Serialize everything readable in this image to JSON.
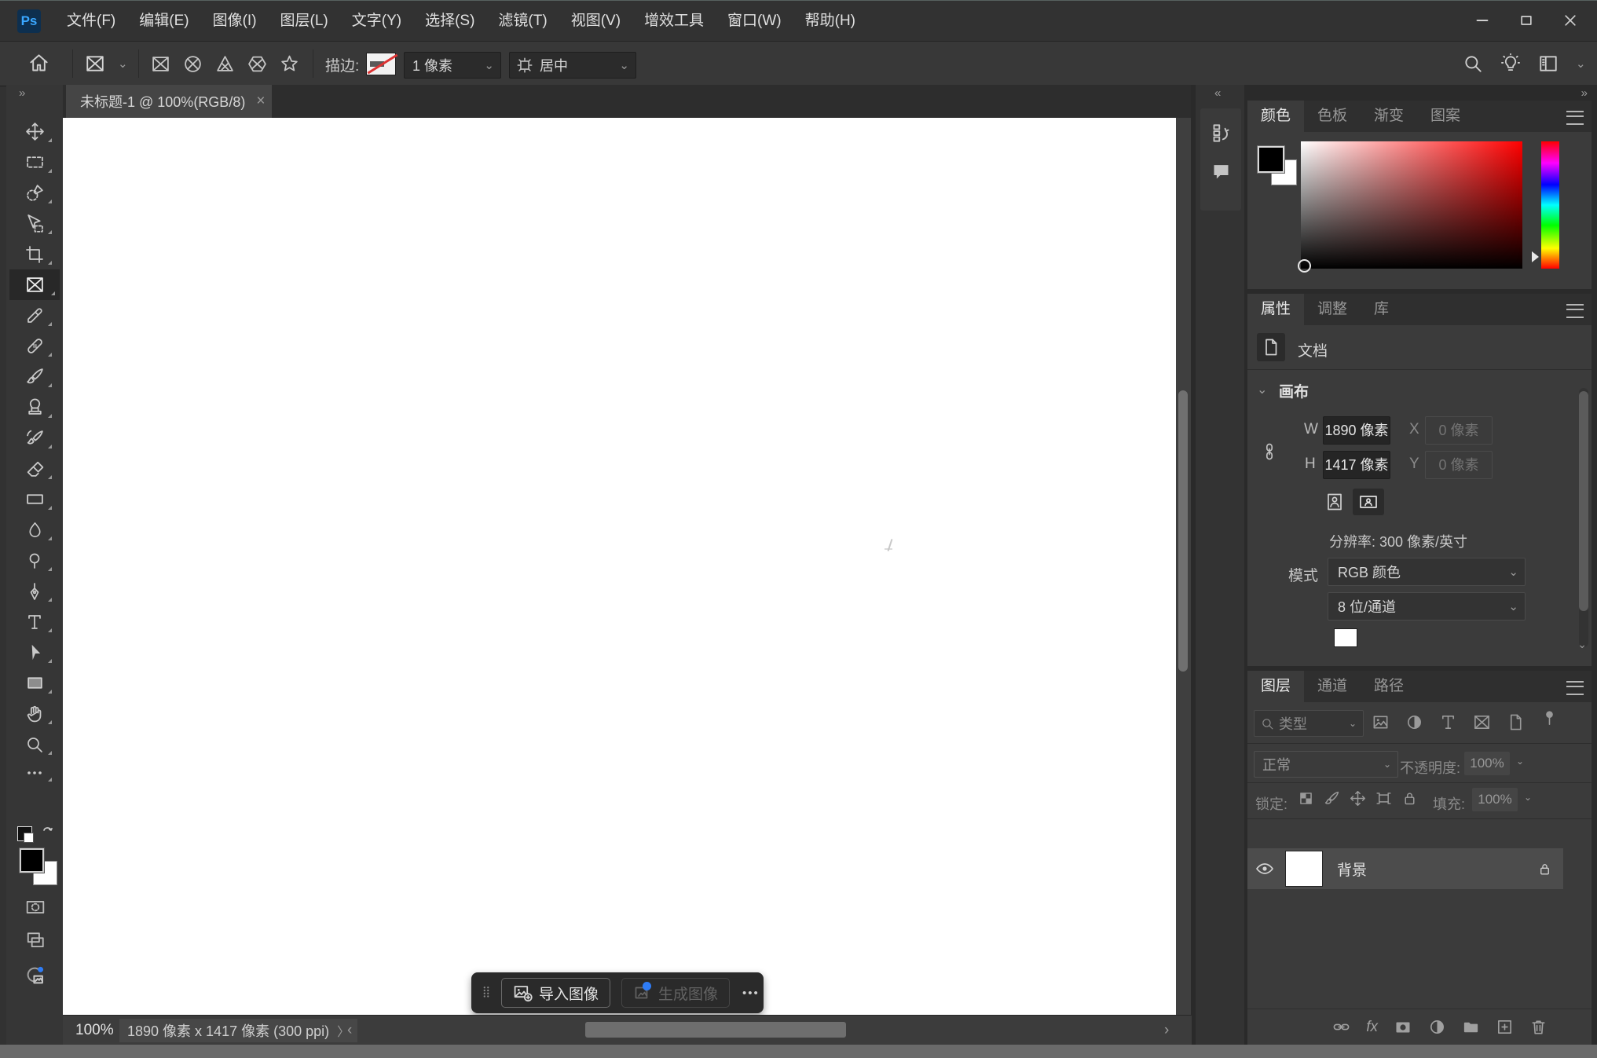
{
  "glyphs": {
    "chevron_down": "⌄",
    "collapse_right": "»",
    "collapse_left": "«",
    "more_h": "•••",
    "angle_right": "〉",
    "scroll_left": "‹",
    "scroll_right": "›",
    "close": "×",
    "fx": "fx"
  },
  "titlebar": {
    "logo": "Ps",
    "menu": [
      "文件(F)",
      "编辑(E)",
      "图像(I)",
      "图层(L)",
      "文字(Y)",
      "选择(S)",
      "滤镜(T)",
      "视图(V)",
      "增效工具",
      "窗口(W)",
      "帮助(H)"
    ]
  },
  "options_bar": {
    "stroke_label": "描边:",
    "stroke_width": "1 像素",
    "align_value": "居中"
  },
  "document_tab": {
    "title": "未标题-1 @ 100%(RGB/8)"
  },
  "task_bar": {
    "import": "导入图像",
    "generate": "生成图像"
  },
  "color_panel": {
    "tabs": [
      "颜色",
      "色板",
      "渐变",
      "图案"
    ]
  },
  "properties_panel": {
    "tabs": [
      "属性",
      "调整",
      "库"
    ],
    "document": "文档",
    "canvas_section": "画布",
    "w": "W",
    "w_value": "1890 像素",
    "x": "X",
    "x_value": "0 像素",
    "h": "H",
    "h_value": "1417 像素",
    "y": "Y",
    "y_value": "0 像素",
    "resolution": "分辨率: 300 像素/英寸",
    "mode": "模式",
    "mode_value": "RGB 颜色",
    "depth_value": "8 位/通道"
  },
  "layers_panel": {
    "tabs": [
      "图层",
      "通道",
      "路径"
    ],
    "filter_placeholder": "类型",
    "blend": "正常",
    "opacity_label": "不透明度:",
    "opacity": "100%",
    "lock_label": "锁定:",
    "fill_label": "填充:",
    "fill": "100%",
    "layer_name": "背景"
  },
  "status_bar": {
    "zoom": "100%",
    "info": "1890 像素 x 1417 像素 (300 ppi)"
  },
  "colors": {
    "accent_blue": "#2e7cf6",
    "canvas": "#ffffff",
    "foreground": "#000000",
    "background": "#ffffff"
  }
}
